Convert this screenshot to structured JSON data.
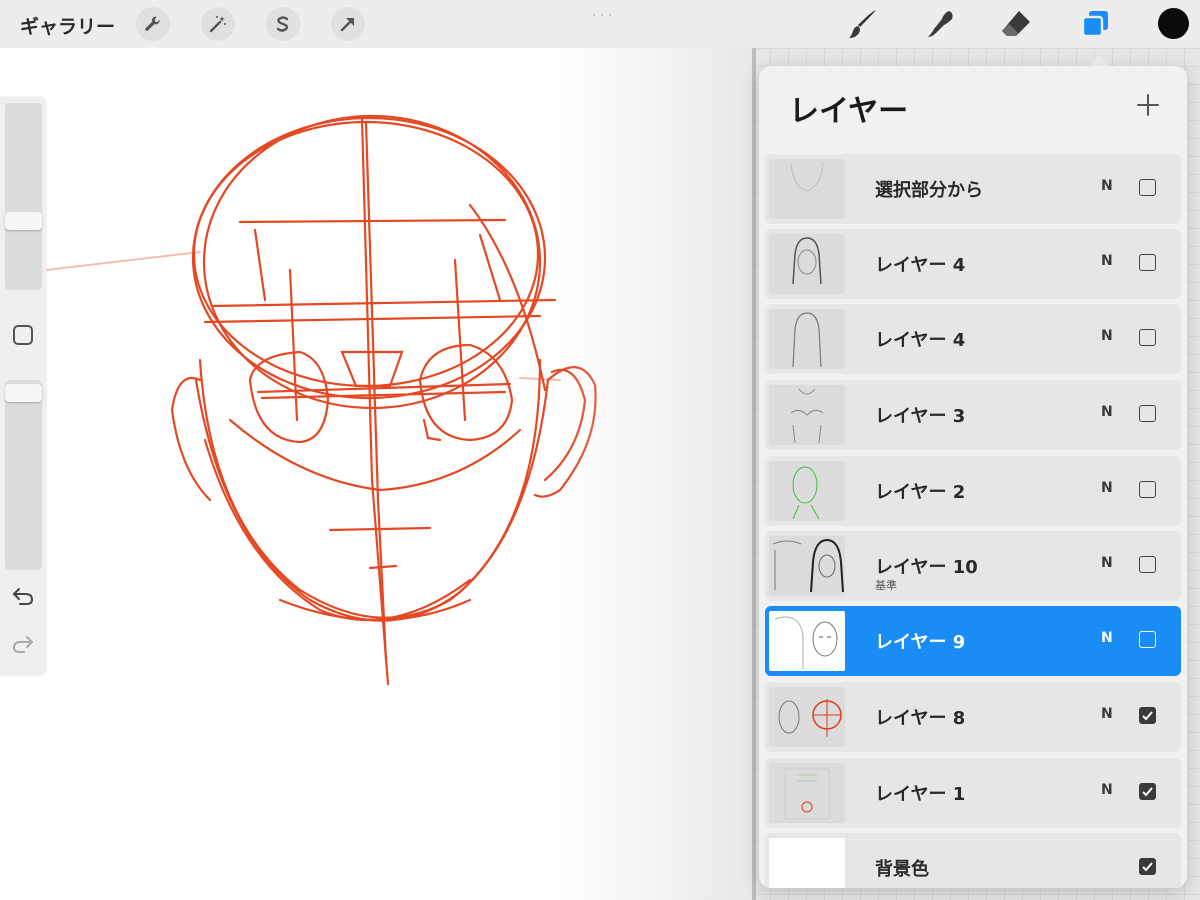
{
  "topbar": {
    "gallery_label": "ギャラリー",
    "left_tools": [
      "wrench-icon",
      "magic-wand-icon",
      "selection-s-icon",
      "transform-arrow-icon"
    ],
    "right_tools": [
      "brush-icon",
      "smudge-icon",
      "eraser-icon",
      "layers-icon"
    ],
    "active_tool": "layers",
    "current_color": "#0b0b0b",
    "accent": "#1a8cf5"
  },
  "layers_panel": {
    "title": "レイヤー",
    "add_icon": "plus-icon",
    "layers": [
      {
        "name": "選択部分から",
        "sub": "",
        "blend": "N",
        "visible": false,
        "selected": false
      },
      {
        "name": "レイヤー 4",
        "sub": "",
        "blend": "N",
        "visible": false,
        "selected": false
      },
      {
        "name": "レイヤー 4",
        "sub": "",
        "blend": "N",
        "visible": false,
        "selected": false
      },
      {
        "name": "レイヤー 3",
        "sub": "",
        "blend": "N",
        "visible": false,
        "selected": false
      },
      {
        "name": "レイヤー 2",
        "sub": "",
        "blend": "N",
        "visible": false,
        "selected": false
      },
      {
        "name": "レイヤー 10",
        "sub": "基準",
        "blend": "N",
        "visible": false,
        "selected": false
      },
      {
        "name": "レイヤー 9",
        "sub": "",
        "blend": "N",
        "visible": false,
        "selected": true
      },
      {
        "name": "レイヤー 8",
        "sub": "",
        "blend": "N",
        "visible": true,
        "selected": false
      },
      {
        "name": "レイヤー 1",
        "sub": "",
        "blend": "N",
        "visible": true,
        "selected": false
      }
    ],
    "background": {
      "name": "背景色",
      "visible": true
    }
  },
  "sidebar": {
    "modifier_icon": "square-modifier-icon",
    "undo_icon": "undo-icon",
    "redo_icon": "redo-icon"
  },
  "sketch_color": "#e23a12"
}
